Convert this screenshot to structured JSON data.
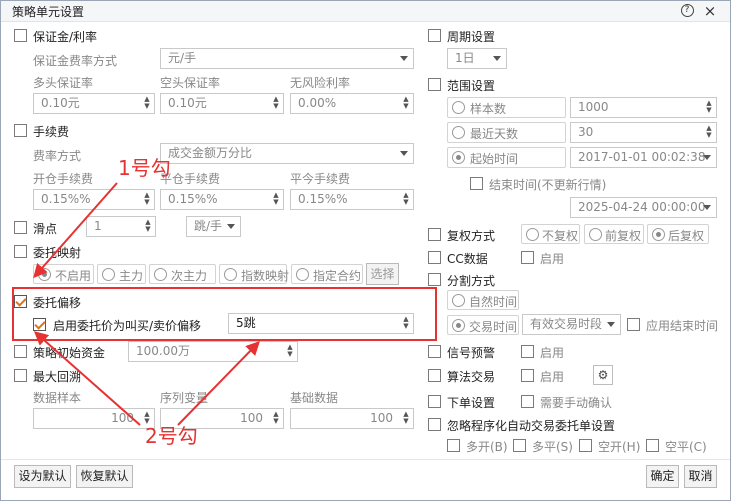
{
  "window": {
    "title": "策略单元设置",
    "help_icon": "?",
    "close_icon": "×"
  },
  "margin": {
    "section": "保证金/利率",
    "fee_mode_label": "保证金费率方式",
    "fee_mode_value": "元/手",
    "long_label": "多头保证率",
    "short_label": "空头保证率",
    "riskfree_label": "无风险利率",
    "long_value": "0.10元",
    "short_value": "0.10元",
    "riskfree_value": "0.00%"
  },
  "fees": {
    "section": "手续费",
    "mode_label": "费率方式",
    "mode_value": "成交金额万分比",
    "open_label": "开仓手续费",
    "close_today_label": "平仓手续费",
    "close_label": "平今手续费",
    "open_value": "0.15%%",
    "close_today_value": "0.15%%",
    "close_value": "0.15%%"
  },
  "slippage": {
    "label": "滑点",
    "value": "1",
    "unit": "跳/手"
  },
  "mapping": {
    "label": "委托映射",
    "options": [
      "不启用",
      "主力",
      "次主力",
      "指数映射",
      "指定合约"
    ],
    "select_button": "选择"
  },
  "offset": {
    "label": "委托偏移",
    "enable_label": "启用委托价为叫买/卖价偏移",
    "value": "5跳"
  },
  "initial_capital": {
    "label": "策略初始资金",
    "value": "100.00万"
  },
  "drawdown": {
    "label": "最大回溯",
    "sample_label": "数据样本",
    "series_label": "序列变量",
    "base_label": "基础数据",
    "sample_value": "100",
    "series_value": "100",
    "base_value": "100"
  },
  "period": {
    "label": "周期设置",
    "value": "1日"
  },
  "range": {
    "label": "范围设置",
    "samples_label": "样本数",
    "samples_value": "1000",
    "recent_days_label": "最近天数",
    "recent_days_value": "30",
    "start_time_label": "起始时间",
    "start_time_value": "2017-01-01 00:02:38",
    "end_time_label": "结束时间(不更新行情)",
    "end_time_value": "2025-04-24 00:00:00"
  },
  "adjust": {
    "label": "复权方式",
    "options": [
      "不复权",
      "前复权",
      "后复权"
    ]
  },
  "cc": {
    "label": "CC数据",
    "enable": "启用"
  },
  "split": {
    "label": "分割方式",
    "natural_time": "自然时间",
    "trading_time": "交易时间",
    "trading_period_value": "有效交易时段",
    "apply_end_time": "应用结束时间"
  },
  "signal": {
    "label": "信号预警",
    "enable": "启用"
  },
  "algo": {
    "label": "算法交易",
    "enable": "启用",
    "gear_icon": "⚙"
  },
  "order": {
    "label": "下单设置",
    "manual_confirm": "需要手动确认"
  },
  "ignore": {
    "label": "忽略程序化自动交易委托单设置",
    "options": [
      "多开(B)",
      "多平(S)",
      "空开(H)",
      "空平(C)"
    ]
  },
  "footer": {
    "set_default": "设为默认",
    "restore_default": "恢复默认",
    "ok": "确定",
    "cancel": "取消"
  },
  "annotations": {
    "check1": "1号勾",
    "check2": "2号勾"
  },
  "colors": {
    "annotation_red": "#e53232",
    "check_orange": "#e0731a"
  }
}
